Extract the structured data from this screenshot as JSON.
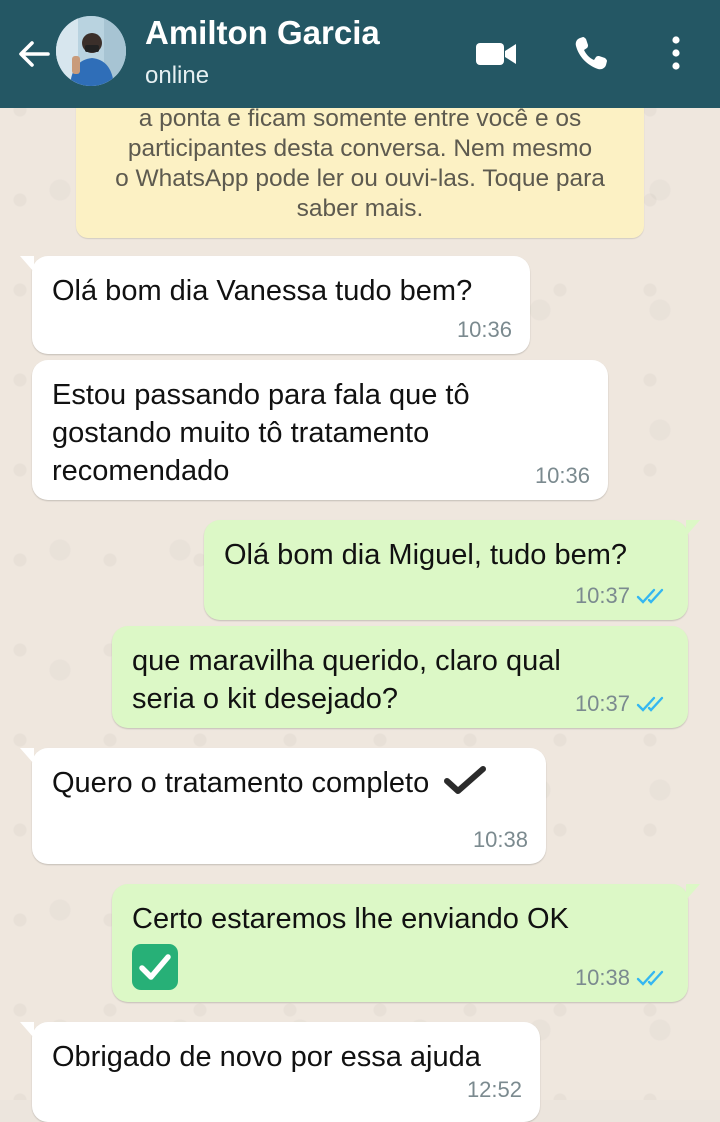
{
  "header": {
    "contact_name": "Amilton Garcia",
    "status": "online",
    "background_color": "#245764"
  },
  "notice": {
    "lines": [
      "a ponta e ficam somente entre você e os",
      "participantes desta conversa. Nem mesmo",
      "o WhatsApp pode ler ou ouvi-las. Toque para",
      "saber mais."
    ]
  },
  "messages": [
    {
      "direction": "in",
      "text": "Olá bom dia Vanessa tudo bem?",
      "time": "10:36"
    },
    {
      "direction": "in",
      "lines": [
        "Estou passando para fala que tô",
        "gostando muito tô tratamento",
        "recomendado"
      ],
      "time": "10:36"
    },
    {
      "direction": "out",
      "text": "Olá bom dia Miguel, tudo bem?",
      "time": "10:37",
      "read": true
    },
    {
      "direction": "out",
      "lines": [
        "que maravilha querido, claro qual",
        "seria o kit desejado?"
      ],
      "time": "10:37",
      "read": true
    },
    {
      "direction": "in",
      "text": "Quero o tratamento completo",
      "emoji": "heavy-check-mark",
      "time": "10:38"
    },
    {
      "direction": "out",
      "text": "Certo estaremos lhe enviando OK",
      "emoji": "white-check-mark-button",
      "time": "10:38",
      "read": true
    },
    {
      "direction": "in",
      "text": "Obrigado de novo por essa ajuda",
      "time": "12:52"
    }
  ],
  "colors": {
    "incoming_bubble": "#ffffff",
    "outgoing_bubble": "#dcf8c6",
    "read_ticks": "#34b7f1",
    "notice_bg": "#fcf1c4"
  }
}
